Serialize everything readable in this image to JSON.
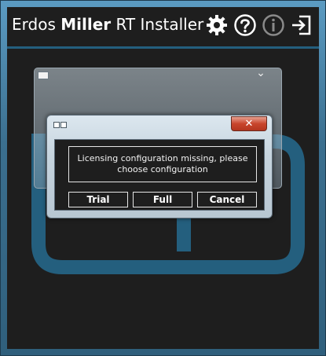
{
  "app": {
    "title_part1": "Erdos ",
    "title_part2": "Miller",
    "title_part3": " RT Installer"
  },
  "toolbar": {
    "icons": [
      "gear-icon",
      "help-icon",
      "info-icon",
      "exit-icon"
    ]
  },
  "dialog": {
    "close_label": "✕",
    "message": "Licensing configuration missing, please choose configuration",
    "buttons": {
      "trial": "Trial",
      "full": "Full",
      "cancel": "Cancel"
    }
  },
  "colors": {
    "window_frame": "#3f7797",
    "panel_bg": "#1e1e1e",
    "accent_logo": "#245f7e",
    "close_red": "#c8452c"
  }
}
